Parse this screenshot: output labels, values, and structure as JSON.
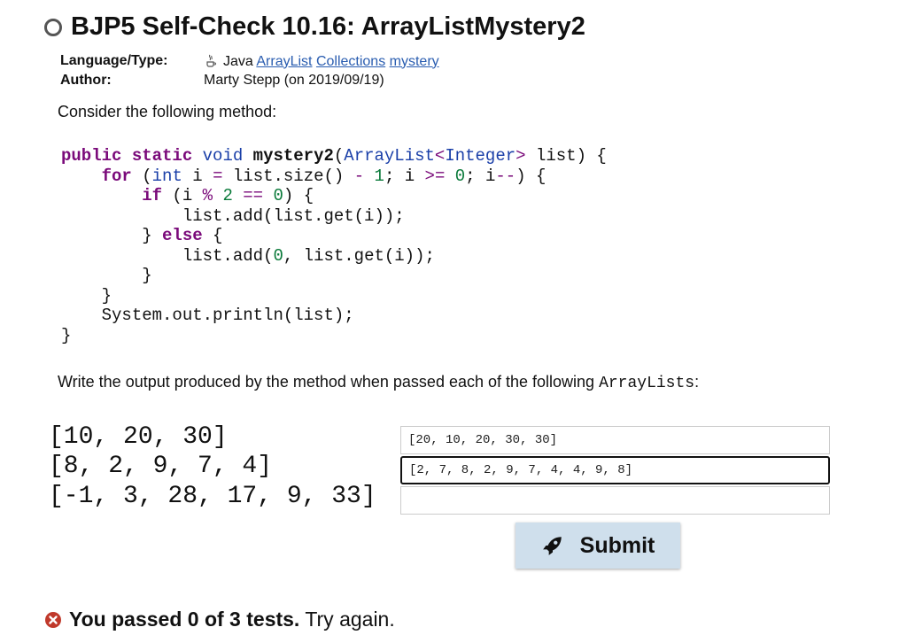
{
  "page": {
    "title": "BJP5 Self-Check 10.16: ArrayListMystery2"
  },
  "meta": {
    "language_label": "Language/Type:",
    "language_text": "Java",
    "tags": [
      "ArrayList",
      "Collections",
      "mystery"
    ],
    "author_label": "Author:",
    "author_value": "Marty Stepp (on 2019/09/19)"
  },
  "problem": {
    "intro": "Consider the following method:",
    "write_prefix": "Write the output produced by the method when passed each of the following ",
    "write_code": "ArrayLists",
    "write_suffix": ":"
  },
  "cases": [
    {
      "input": "[10, 20, 30]",
      "answer": "[20, 10, 20, 30, 30]"
    },
    {
      "input": "[8, 2, 9, 7, 4]",
      "answer": "[2, 7, 8, 2, 9, 7, 4, 4, 9, 8]"
    },
    {
      "input": "[-1, 3, 28, 17, 9, 33]",
      "answer": ""
    }
  ],
  "submit_label": "Submit",
  "result": {
    "strong": "You passed 0 of 3 tests.",
    "rest": "Try again."
  },
  "icons": {
    "status": "circle-outline-icon",
    "java": "java-cup-icon",
    "submit": "rocket-icon",
    "fail": "x-circle-icon"
  }
}
